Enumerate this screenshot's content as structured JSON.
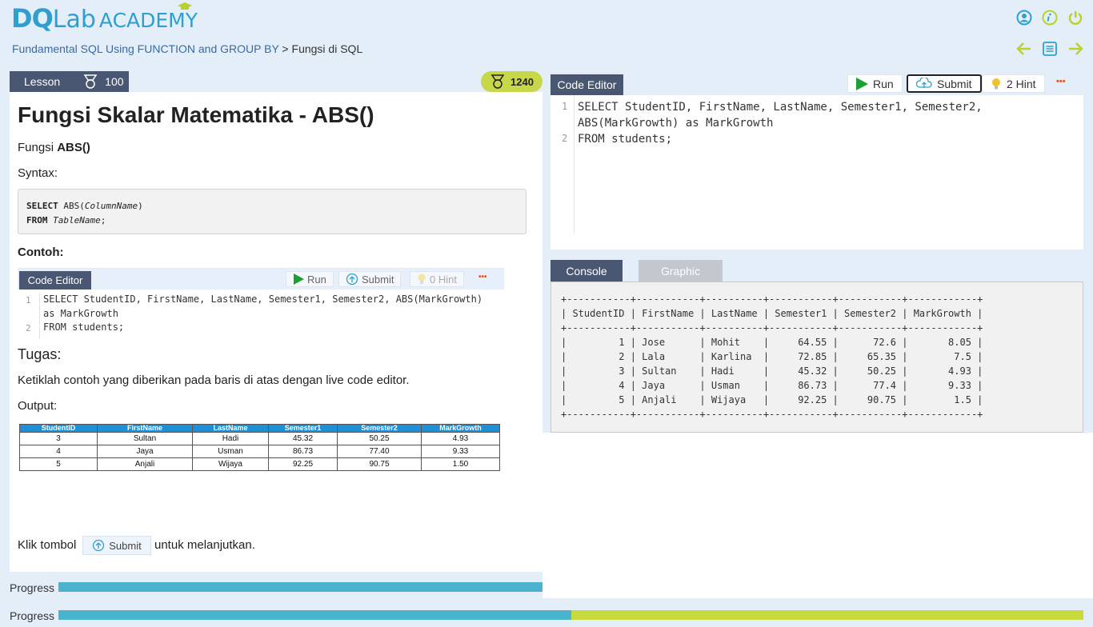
{
  "header": {
    "logo_dq": "DQ",
    "logo_lab": "Lab",
    "logo_academy": "ACADEMY",
    "icons": [
      "user-icon",
      "info-icon",
      "power-icon"
    ],
    "nav_icons": [
      "arrow-left-icon",
      "list-icon",
      "arrow-right-icon"
    ]
  },
  "breadcrumb": {
    "course": "Fundamental SQL Using FUNCTION and GROUP BY",
    "separator": " > ",
    "current": "Fungsi di SQL"
  },
  "lesson": {
    "tab_label": "Lesson",
    "tab_points": "100",
    "total_points": "1240",
    "title": "Fungsi Skalar Matematika - ABS()",
    "intro_prefix": "Fungsi ",
    "intro_bold": "ABS()",
    "syntax_label": "Syntax:",
    "syntax_line1_kw": "SELECT",
    "syntax_line1_fn": " ABS(",
    "syntax_line1_arg": "ColumnName",
    "syntax_line1_end": ")",
    "syntax_line2_kw": "FROM",
    "syntax_line2_arg": "TableName",
    "syntax_line2_end": ";",
    "contoh_label": "Contoh:",
    "tugas_label": "Tugas:",
    "tugas_text": "Ketiklah contoh yang diberikan pada baris di atas dengan live code editor.",
    "output_label": "Output:",
    "footer_prefix": "Klik tombol",
    "footer_button": "Submit",
    "footer_suffix": "untuk melanjutkan."
  },
  "example_editor": {
    "tab": "Code Editor",
    "run": "Run",
    "submit": "Submit",
    "hint": "0 Hint",
    "more": "•••",
    "lines": [
      {
        "num": "1",
        "text": "SELECT StudentID, FirstName, LastName, Semester1, Semester2, ABS(MarkGrowth)"
      },
      {
        "num": "",
        "text": "as MarkGrowth"
      },
      {
        "num": "2",
        "text": "FROM students;"
      }
    ]
  },
  "output_table": {
    "headers": [
      "StudentID",
      "FirstName",
      "LastName",
      "Semester1",
      "Semester2",
      "MarkGrowth"
    ],
    "rows": [
      [
        "3",
        "Sultan",
        "Hadi",
        "45.32",
        "50.25",
        "4.93"
      ],
      [
        "4",
        "Jaya",
        "Usman",
        "86.73",
        "77.40",
        "9.33"
      ],
      [
        "5",
        "Anjali",
        "Wijaya",
        "92.25",
        "90.75",
        "1.50"
      ]
    ]
  },
  "editor": {
    "tab": "Code Editor",
    "run": "Run",
    "submit": "Submit",
    "hint": "2 Hint",
    "more": "•••",
    "line1": "SELECT StudentID, FirstName, LastName, Semester1, Semester2,",
    "line1b": "ABS(MarkGrowth) as MarkGrowth",
    "line2": "FROM students;",
    "ln1": "1",
    "ln2": "2"
  },
  "console": {
    "tab_console": "Console",
    "tab_graphic": "Graphic",
    "output": "+-----------+-----------+----------+-----------+-----------+------------+\n| StudentID | FirstName | LastName | Semester1 | Semester2 | MarkGrowth |\n+-----------+-----------+----------+-----------+-----------+------------+\n|         1 | Jose      | Mohit    |     64.55 |      72.6 |       8.05 |\n|         2 | Lala      | Karlina  |     72.85 |     65.35 |        7.5 |\n|         3 | Sultan    | Hadi     |     45.32 |     50.25 |       4.93 |\n|         4 | Jaya      | Usman    |     86.73 |      77.4 |       9.33 |\n|         5 | Anjali    | Wijaya   |     92.25 |     90.75 |        1.5 |\n+-----------+-----------+----------+-----------+-----------+------------+"
  },
  "progress": {
    "label1": "Progress",
    "label2": "Progress",
    "bar1_fraction": 1.0,
    "bar2_fraction": 0.5,
    "bar_color": "#4ab4cf",
    "track_color": "#c8da3c"
  },
  "colors": {
    "brand": "#2f9fd0",
    "tab_dark": "#4a5772",
    "points_pill": "#c6d84a",
    "accent_green": "#b9d12a"
  }
}
